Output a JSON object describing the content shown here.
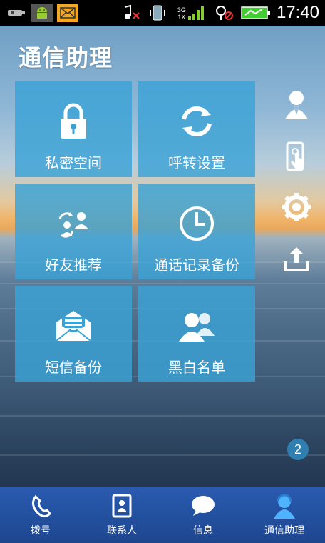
{
  "status_bar": {
    "time": "17:40",
    "network_label_top": "3G",
    "network_label_bottom": "1X"
  },
  "app": {
    "title": "通信助理"
  },
  "tiles": [
    {
      "label": "私密空间",
      "icon": "lock-icon"
    },
    {
      "label": "呼转设置",
      "icon": "call-forward-icon"
    },
    {
      "label": "好友推荐",
      "icon": "friend-recommend-icon"
    },
    {
      "label": "通话记录备份",
      "icon": "clock-icon"
    },
    {
      "label": "短信备份",
      "icon": "envelope-icon"
    },
    {
      "label": "黑白名单",
      "icon": "contacts-group-icon"
    }
  ],
  "side_actions": [
    {
      "icon": "profile-icon"
    },
    {
      "icon": "touch-phone-icon"
    },
    {
      "icon": "settings-gear-icon"
    },
    {
      "icon": "upload-icon"
    }
  ],
  "page_indicator": "2",
  "bottom_nav": [
    {
      "label": "拨号",
      "icon": "dialer-icon",
      "active": false
    },
    {
      "label": "联系人",
      "icon": "contacts-icon",
      "active": false
    },
    {
      "label": "信息",
      "icon": "message-bubble-icon",
      "active": false
    },
    {
      "label": "通信助理",
      "icon": "assistant-icon",
      "active": true
    }
  ],
  "colors": {
    "tile_bg": "#3aa2d6",
    "nav_bg": "#2a5bb0",
    "status_bar_bg": "#000000"
  }
}
